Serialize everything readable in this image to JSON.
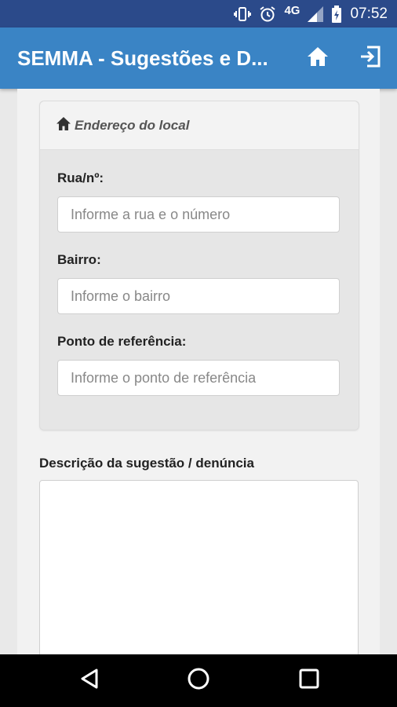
{
  "status_bar": {
    "network": "4G",
    "time": "07:52",
    "icons": [
      "vibrate-icon",
      "alarm-icon",
      "signal-icon",
      "battery-icon"
    ]
  },
  "app_bar": {
    "title": "SEMMA - Sugestões e D...",
    "actions": [
      "home-icon",
      "logout-icon"
    ],
    "color": "#3a84c5"
  },
  "address_panel": {
    "title": "Endereço do local",
    "fields": [
      {
        "label": "Rua/nº:",
        "placeholder": "Informe a rua e o número",
        "value": ""
      },
      {
        "label": "Bairro:",
        "placeholder": "Informe o bairro",
        "value": ""
      },
      {
        "label": "Ponto de referência:",
        "placeholder": "Informe o ponto de referência",
        "value": ""
      }
    ]
  },
  "description": {
    "label": "Descrição da sugestão / denúncia",
    "value": ""
  },
  "nav_bar": {
    "buttons": [
      "back-icon",
      "home-circle-icon",
      "recents-icon"
    ]
  }
}
